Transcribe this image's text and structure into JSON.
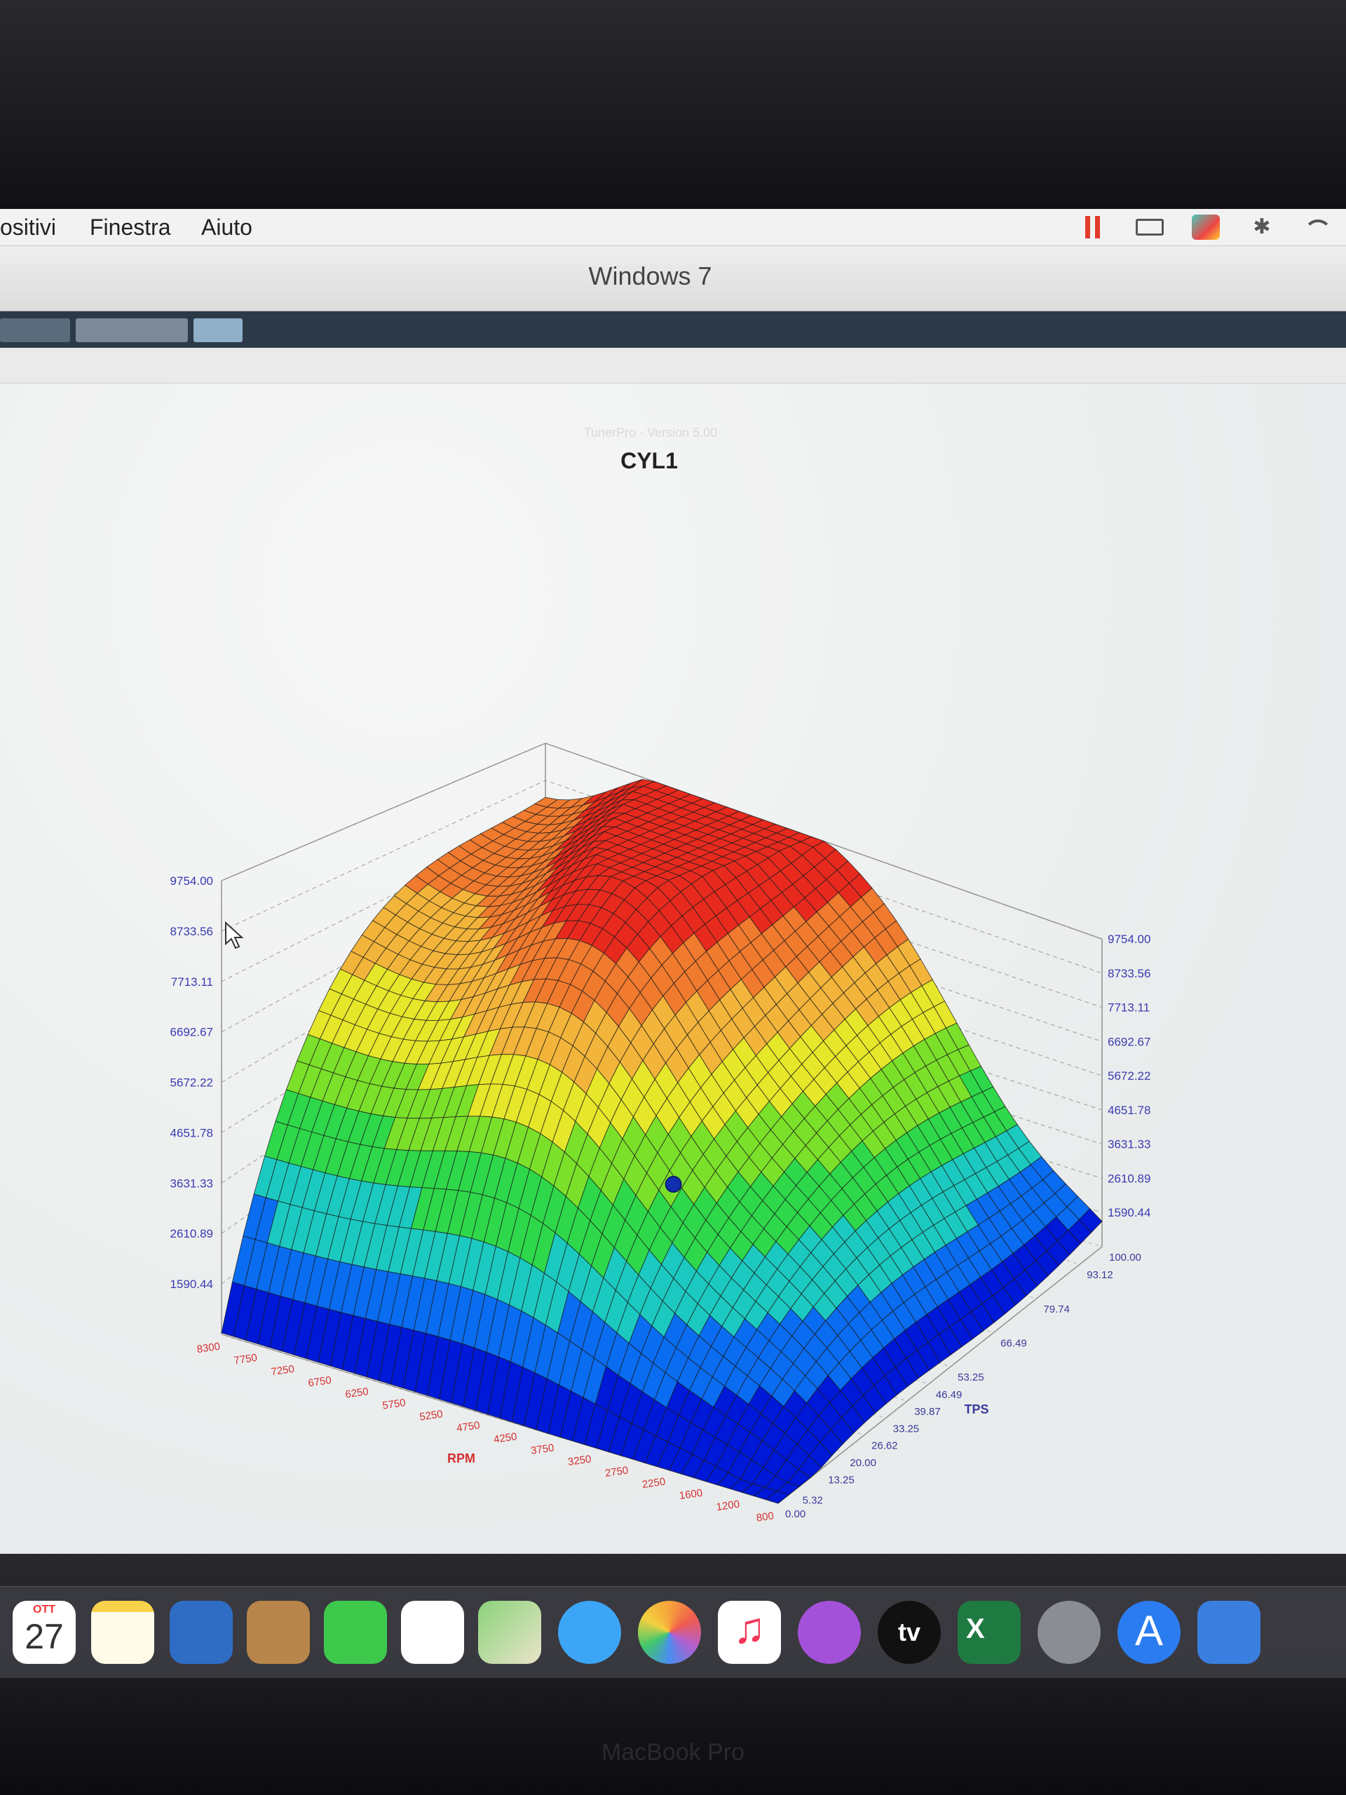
{
  "menubar": {
    "items": [
      "ositivi",
      "Finestra",
      "Aiuto"
    ]
  },
  "window": {
    "title": "Windows 7"
  },
  "tunerpro": {
    "watermark": "TunerPro - Version 5.00"
  },
  "chart_data": {
    "type": "surface",
    "title": "CYL1",
    "xlabel": "RPM",
    "ylabel": "TPS",
    "x_ticks": [
      "8300",
      "7750",
      "7250",
      "6750",
      "6250",
      "5750",
      "5250",
      "4750",
      "4250",
      "3750",
      "3250",
      "2750",
      "2250",
      "1600",
      "1200",
      "800"
    ],
    "y_ticks": [
      "0.00",
      "5.32",
      "13.25",
      "20.00",
      "26.62",
      "33.25",
      "39.87",
      "46.49",
      "53.25",
      "66.49",
      "79.74",
      "93.12",
      "100.00"
    ],
    "z_ticks": [
      "1590.44",
      "2610.89",
      "3631.33",
      "4651.78",
      "5672.22",
      "6692.67",
      "7713.11",
      "8733.56",
      "9754.00"
    ],
    "zlim": [
      570,
      9754
    ],
    "selected_point_z": 3631.33,
    "colormap": [
      "#0018d8",
      "#0a6cf0",
      "#1cc9c0",
      "#2ed84a",
      "#7be02a",
      "#e6e62a",
      "#f2b43a",
      "#f07a2e",
      "#e82a1e"
    ]
  },
  "dock": {
    "calendar_month": "OTT",
    "calendar_day": "27",
    "tv_label": "tv",
    "excel_label": "X",
    "brand": "MacBook Pro"
  }
}
